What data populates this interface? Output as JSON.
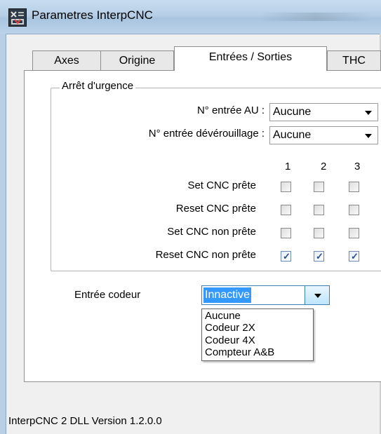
{
  "window": {
    "title": "Parametres InterpCNC"
  },
  "tabs": [
    {
      "label": "Axes",
      "active": false
    },
    {
      "label": "Origine",
      "active": false
    },
    {
      "label": "Entrées / Sorties",
      "active": true
    },
    {
      "label": "THC",
      "active": false
    }
  ],
  "emergency": {
    "legend": "Arrêt d'urgence",
    "au_input": {
      "label": "N° entrée AU :",
      "value": "Aucune"
    },
    "unlock_input": {
      "label": "N° entrée dévérouillage :",
      "value": "Aucune"
    },
    "columns": [
      "1",
      "2",
      "3"
    ],
    "rows": [
      {
        "label": "Set CNC prête",
        "checks": [
          false,
          false,
          false
        ]
      },
      {
        "label": "Reset CNC prête",
        "checks": [
          false,
          false,
          false
        ]
      },
      {
        "label": "Set CNC non prête",
        "checks": [
          false,
          false,
          false
        ]
      },
      {
        "label": "Reset CNC non prête",
        "checks": [
          true,
          true,
          true
        ]
      }
    ]
  },
  "encoder": {
    "label": "Entrée codeur",
    "value": "Innactive",
    "options": [
      "Aucune",
      "Codeur 2X",
      "Codeur 4X",
      "Compteur A&B"
    ]
  },
  "status": {
    "version": "InterpCNC 2 DLL Version 1.2.0.0"
  },
  "colors": {
    "selection": "#3399ff",
    "titlebar": "#b6cfe6",
    "check": "#2a4d8a"
  }
}
